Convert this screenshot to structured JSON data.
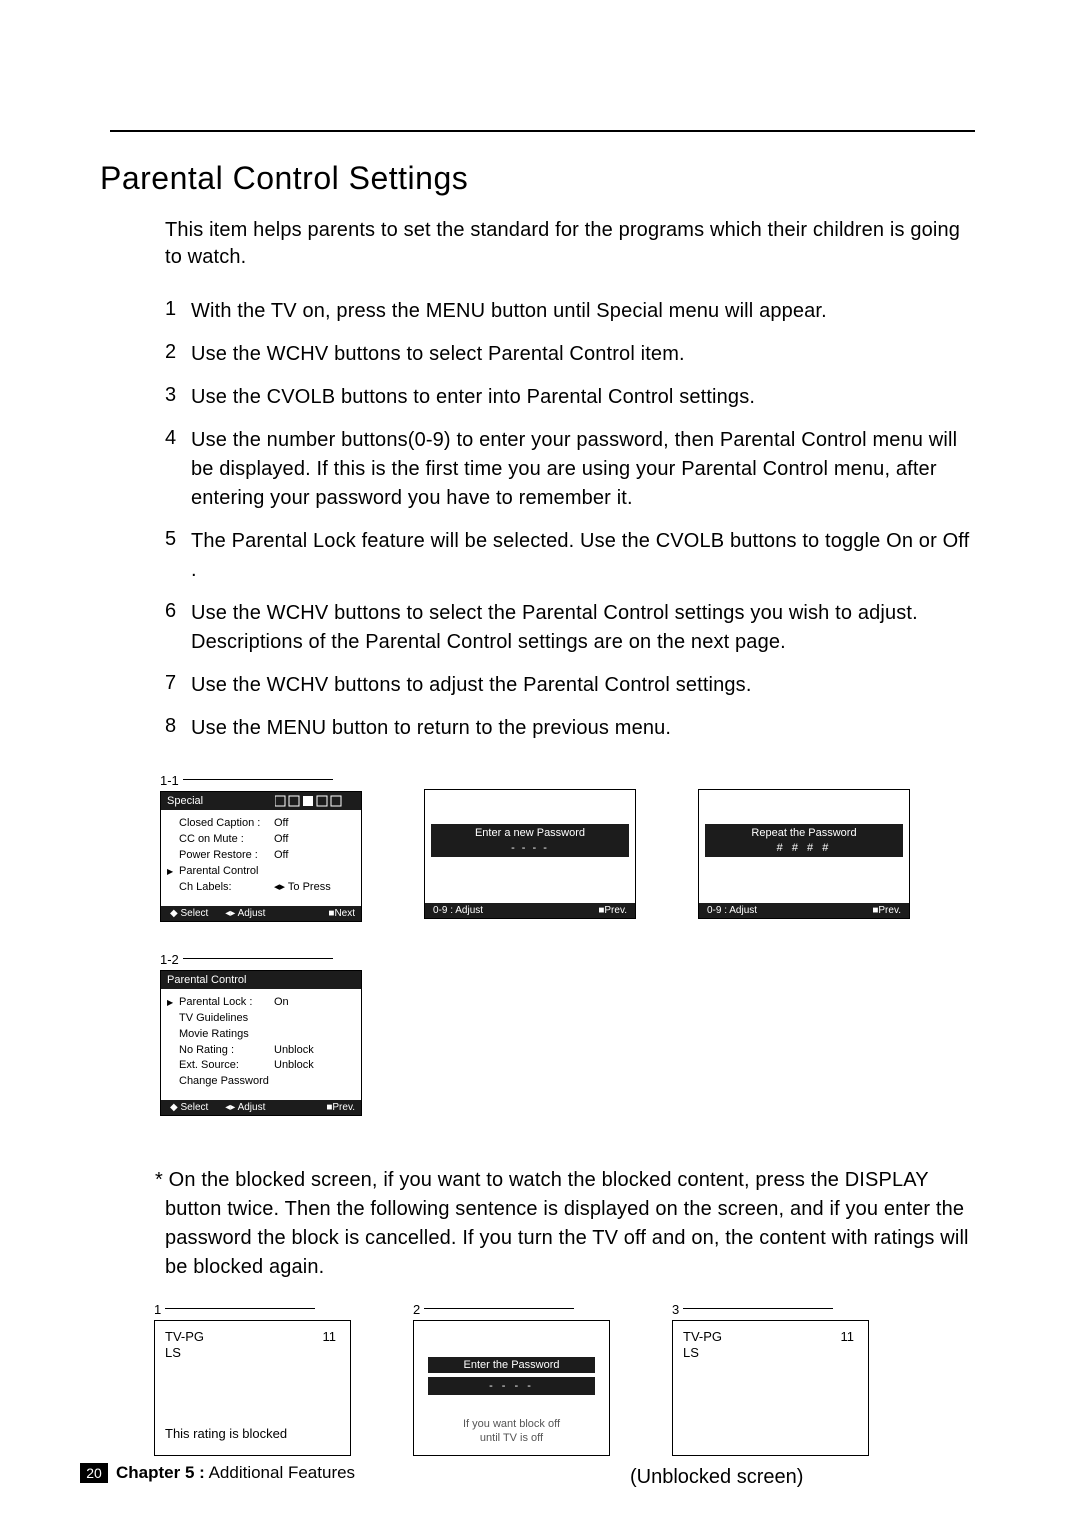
{
  "title": "Parental Control Settings",
  "intro": "This item helps parents to set the standard for the programs which their children is going to watch.",
  "steps": [
    "With the TV on, press the MENU button until  Special  menu will appear.",
    "Use the WCHV  buttons to select  Parental Control  item.",
    "Use the CVOLB  buttons to enter into  Parental Control  settings.",
    "Use the number buttons(0-9) to enter your password, then  Parental Control  menu will be displayed. If this is the first time you are using your   Parental Control  menu, after entering your password you have to remember it.",
    "The Parental Lock feature will be selected. Use the CVOLB  buttons to toggle  On  or  Off .",
    "Use the WCHV  buttons to select the Parental Control settings you wish to adjust. Descriptions of the Parental Control settings are on the next page.",
    "Use the WCHV  buttons to adjust the Parental Control settings.",
    "Use the MENU button to return to the previous menu."
  ],
  "figure_labels": {
    "one_one": "1-1",
    "one_two": "1-2",
    "seq1": "1",
    "seq2": "2",
    "seq3": "3"
  },
  "osd_special": {
    "title": "Special",
    "rows": [
      {
        "key": "Closed Caption :",
        "val": "Off"
      },
      {
        "key": "CC on Mute :",
        "val": "Off"
      },
      {
        "key": "Power Restore :",
        "val": "Off"
      },
      {
        "key": "Parental Control",
        "val": "",
        "active": true
      },
      {
        "key": "Ch Labels:",
        "val": "◂▸ To Press"
      }
    ],
    "foot": {
      "select": "Select",
      "adjust": "Adjust",
      "next": "Next"
    }
  },
  "osd_newpw": {
    "title": "Enter a new Password",
    "mask": "- - - -",
    "foot_left": "0-9 : Adjust",
    "foot_right": "Prev."
  },
  "osd_repeatpw": {
    "title": "Repeat the Password",
    "mask": "# # # #",
    "foot_left": "0-9 : Adjust",
    "foot_right": "Prev."
  },
  "osd_parental": {
    "title": "Parental Control",
    "rows": [
      {
        "key": "Parental Lock :",
        "val": "On",
        "active": true
      },
      {
        "key": "TV Guidelines",
        "val": ""
      },
      {
        "key": "Movie Ratings",
        "val": ""
      },
      {
        "key": "No Rating :",
        "val": "Unblock"
      },
      {
        "key": "Ext. Source:",
        "val": "Unblock"
      },
      {
        "key": "Change Password",
        "val": ""
      }
    ],
    "foot": {
      "select": "Select",
      "adjust": "Adjust",
      "prev": "Prev."
    }
  },
  "note": "* On the blocked screen, if you want to watch the blocked content, press the DISPLAY button twice. Then the following sentence is displayed on the screen, and if you enter the password the block is cancelled. If you turn the TV off and on, the content with ratings will be blocked again.",
  "blocked_screen": {
    "rating": "TV-PG",
    "flags": "LS",
    "channel": "11",
    "msg": "This rating is blocked"
  },
  "enter_pw_screen": {
    "title": "Enter the Password",
    "mask": "- - - -",
    "msg1": "If you want block off",
    "msg2": "until TV is off"
  },
  "unblocked_screen": {
    "rating": "TV-PG",
    "flags": "LS",
    "channel": "11"
  },
  "caption": "(Unblocked screen)",
  "footer": {
    "page": "20",
    "chapter_label": "Chapter 5 :",
    "chapter_title": "  Additional Features"
  },
  "symbols": {
    "updown": "◆",
    "leftright": "◂▸",
    "square": "■"
  }
}
